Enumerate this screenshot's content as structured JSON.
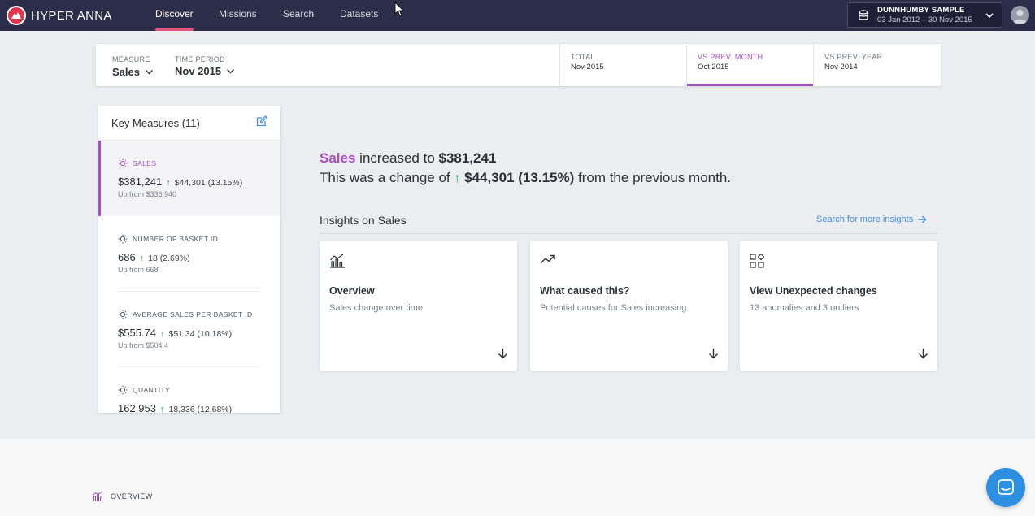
{
  "app": {
    "name": "HYPER ANNA"
  },
  "nav": {
    "tabs": [
      {
        "label": "Discover",
        "active": true
      },
      {
        "label": "Missions"
      },
      {
        "label": "Search"
      },
      {
        "label": "Datasets"
      }
    ]
  },
  "dataset": {
    "name": "DUNNHUMBY SAMPLE",
    "range": "03 Jan 2012 – 30 Nov 2015"
  },
  "filters": {
    "measure_label": "MEASURE",
    "measure_value": "Sales",
    "period_label": "TIME PERIOD",
    "period_value": "Nov 2015",
    "compare": [
      {
        "label": "TOTAL",
        "value": "Nov 2015"
      },
      {
        "label": "VS PREV. MONTH",
        "value": "Oct 2015",
        "active": true
      },
      {
        "label": "VS PREV. YEAR",
        "value": "Nov 2014"
      }
    ]
  },
  "key_measures": {
    "title": "Key Measures (11)",
    "items": [
      {
        "name": "SALES",
        "value": "$381,241",
        "change": "$44,301 (13.15%)",
        "from": "Up from $336,940",
        "active": true
      },
      {
        "name": "NUMBER OF BASKET ID",
        "value": "686",
        "change": "18 (2.69%)",
        "from": "Up from 668"
      },
      {
        "name": "AVERAGE SALES PER BASKET ID",
        "value": "$555.74",
        "change": "$51.34 (10.18%)",
        "from": "Up from $504.4"
      },
      {
        "name": "QUANTITY",
        "value": "162,953",
        "change": "18,336 (12.68%)",
        "from": ""
      }
    ]
  },
  "headline": {
    "measure": "Sales",
    "mid": " increased to ",
    "value": "$381,241",
    "line2_pre": "This was a change of ",
    "change": "$44,301 (13.15%)",
    "line2_post": " from the previous month."
  },
  "insights": {
    "title": "Insights on Sales",
    "link": "Search for more insights",
    "cards": [
      {
        "title": "Overview",
        "subtitle": "Sales change over time",
        "icon": "chart-icon"
      },
      {
        "title": "What caused this?",
        "subtitle": "Potential causes for Sales increasing",
        "icon": "trend-icon"
      },
      {
        "title": "View Unexpected changes",
        "subtitle": "13 anomalies and 3 outliers",
        "icon": "grid-icon"
      }
    ]
  },
  "section": {
    "label": "OVERVIEW"
  },
  "colors": {
    "accent": "#a64fc2",
    "nav_bg": "#2c2d48",
    "up": "#2aa84a",
    "link": "#3f8ee0"
  }
}
